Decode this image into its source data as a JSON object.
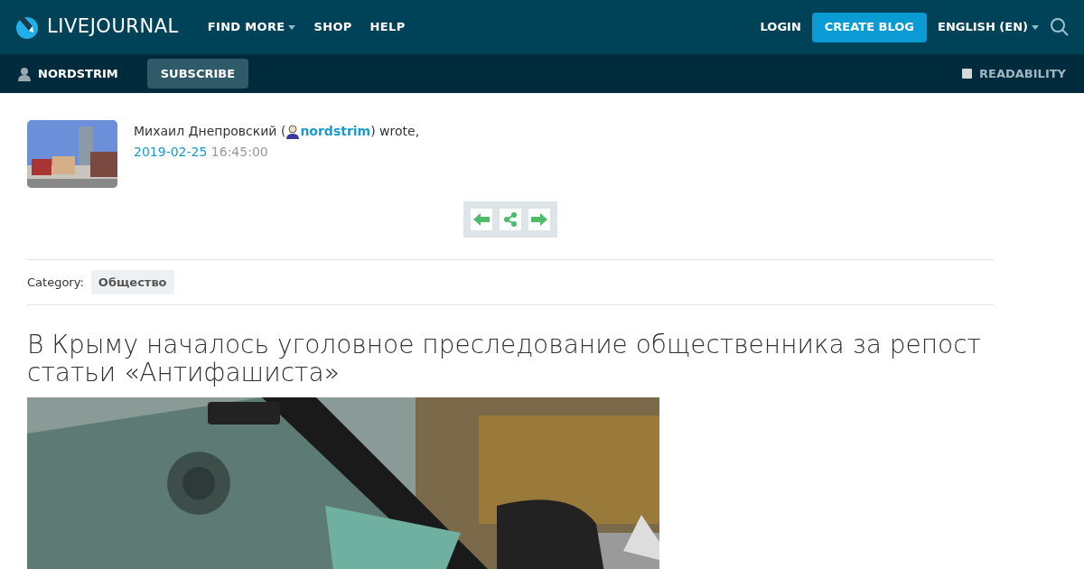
{
  "header": {
    "logo": "LIVEJOURNAL",
    "nav": [
      {
        "label": "FIND MORE",
        "dropdown": true
      },
      {
        "label": "SHOP",
        "dropdown": false
      },
      {
        "label": "HELP",
        "dropdown": false
      }
    ],
    "login": "LOGIN",
    "create": "CREATE BLOG",
    "language": "ENGLISH (EN)"
  },
  "subbar": {
    "user": "NORDSTRIM",
    "subscribe": "SUBSCRIBE",
    "readability": {
      "label": "READABILITY",
      "checked": false
    }
  },
  "post": {
    "author_prefix": "Михаил Днепровский (",
    "username": "nordstrim",
    "author_suffix": ") wrote,",
    "date": "2019-02-25",
    "time": "16:45:00",
    "category_label": "Category:",
    "category": "Общество",
    "title": "В Крыму началось уголовное преследование общественника за репост статьи «Антифашиста»"
  }
}
